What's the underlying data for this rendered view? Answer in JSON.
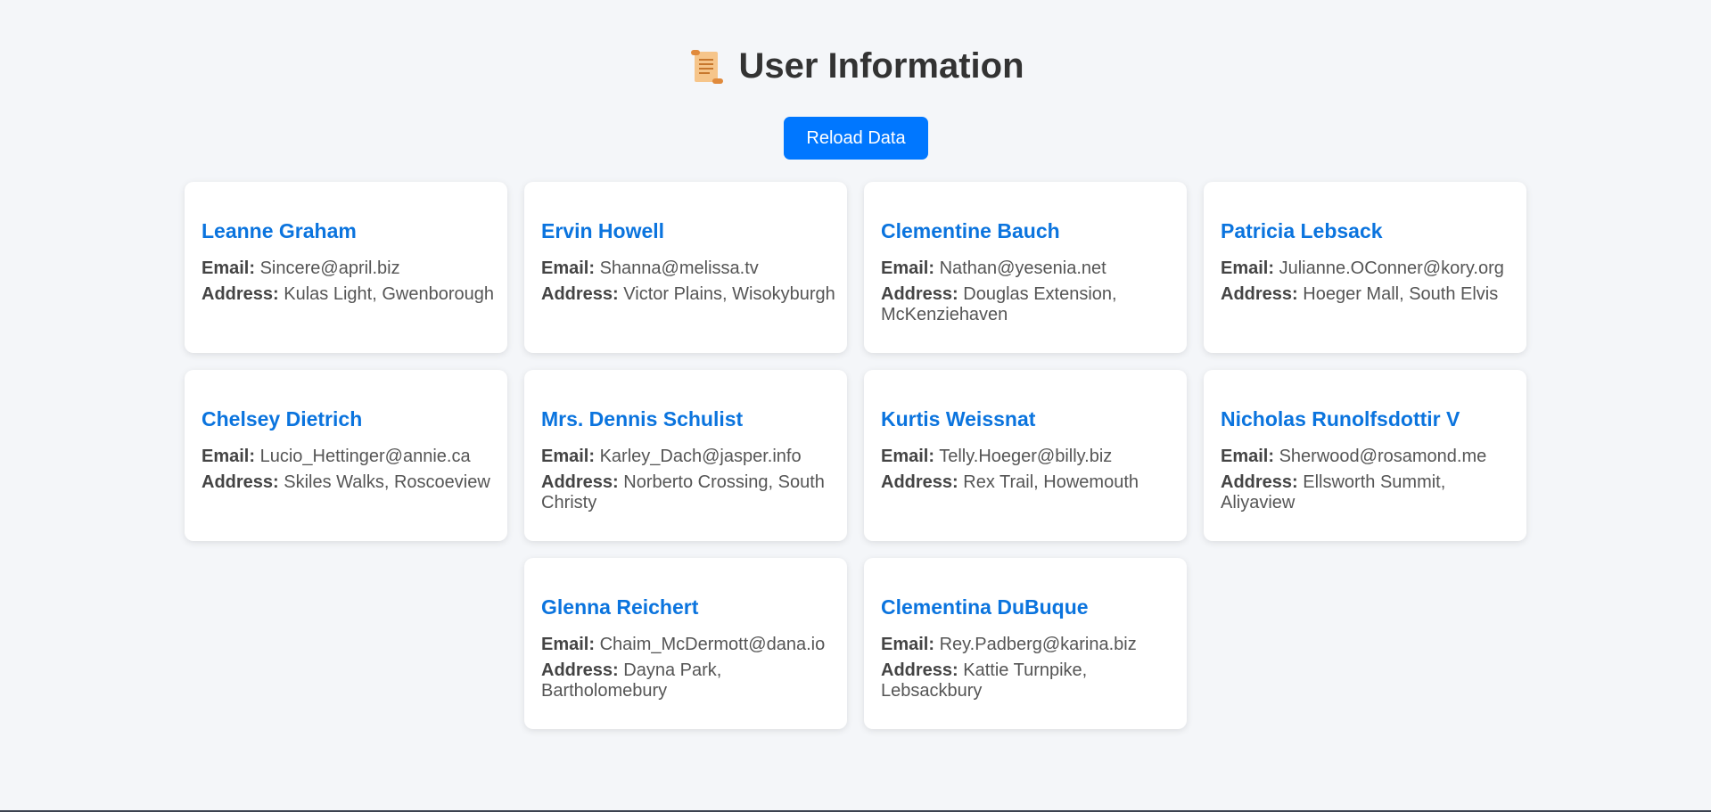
{
  "header": {
    "title": "User Information",
    "icon": "scroll-icon"
  },
  "toolbar": {
    "reload_label": "Reload Data"
  },
  "labels": {
    "email": "Email:",
    "address": "Address:"
  },
  "colors": {
    "accent": "#0077ff",
    "name": "#0b74de",
    "background": "#f4f6f9"
  },
  "users": [
    {
      "name": "Leanne Graham",
      "email": "Sincere@april.biz",
      "address": "Kulas Light, Gwenborough"
    },
    {
      "name": "Ervin Howell",
      "email": "Shanna@melissa.tv",
      "address": "Victor Plains, Wisokyburgh"
    },
    {
      "name": "Clementine Bauch",
      "email": "Nathan@yesenia.net",
      "address": "Douglas Extension, McKenziehaven"
    },
    {
      "name": "Patricia Lebsack",
      "email": "Julianne.OConner@kory.org",
      "address": "Hoeger Mall, South Elvis"
    },
    {
      "name": "Chelsey Dietrich",
      "email": "Lucio_Hettinger@annie.ca",
      "address": "Skiles Walks, Roscoeview"
    },
    {
      "name": "Mrs. Dennis Schulist",
      "email": "Karley_Dach@jasper.info",
      "address": "Norberto Crossing, South Christy"
    },
    {
      "name": "Kurtis Weissnat",
      "email": "Telly.Hoeger@billy.biz",
      "address": "Rex Trail, Howemouth"
    },
    {
      "name": "Nicholas Runolfsdottir V",
      "email": "Sherwood@rosamond.me",
      "address": "Ellsworth Summit, Aliyaview"
    },
    {
      "name": "Glenna Reichert",
      "email": "Chaim_McDermott@dana.io",
      "address": "Dayna Park, Bartholomebury"
    },
    {
      "name": "Clementina DuBuque",
      "email": "Rey.Padberg@karina.biz",
      "address": "Kattie Turnpike, Lebsackbury"
    }
  ]
}
